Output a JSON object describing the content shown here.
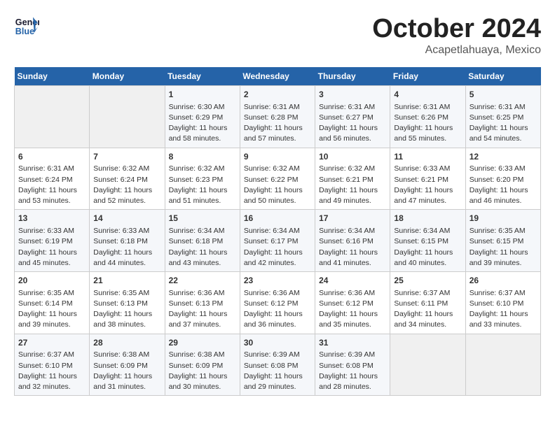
{
  "logo": {
    "line1": "General",
    "line2": "Blue"
  },
  "title": "October 2024",
  "subtitle": "Acapetlahuaya, Mexico",
  "days_of_week": [
    "Sunday",
    "Monday",
    "Tuesday",
    "Wednesday",
    "Thursday",
    "Friday",
    "Saturday"
  ],
  "weeks": [
    [
      {
        "day": "",
        "info": ""
      },
      {
        "day": "",
        "info": ""
      },
      {
        "day": "1",
        "info": "Sunrise: 6:30 AM\nSunset: 6:29 PM\nDaylight: 11 hours\nand 58 minutes."
      },
      {
        "day": "2",
        "info": "Sunrise: 6:31 AM\nSunset: 6:28 PM\nDaylight: 11 hours\nand 57 minutes."
      },
      {
        "day": "3",
        "info": "Sunrise: 6:31 AM\nSunset: 6:27 PM\nDaylight: 11 hours\nand 56 minutes."
      },
      {
        "day": "4",
        "info": "Sunrise: 6:31 AM\nSunset: 6:26 PM\nDaylight: 11 hours\nand 55 minutes."
      },
      {
        "day": "5",
        "info": "Sunrise: 6:31 AM\nSunset: 6:25 PM\nDaylight: 11 hours\nand 54 minutes."
      }
    ],
    [
      {
        "day": "6",
        "info": "Sunrise: 6:31 AM\nSunset: 6:24 PM\nDaylight: 11 hours\nand 53 minutes."
      },
      {
        "day": "7",
        "info": "Sunrise: 6:32 AM\nSunset: 6:24 PM\nDaylight: 11 hours\nand 52 minutes."
      },
      {
        "day": "8",
        "info": "Sunrise: 6:32 AM\nSunset: 6:23 PM\nDaylight: 11 hours\nand 51 minutes."
      },
      {
        "day": "9",
        "info": "Sunrise: 6:32 AM\nSunset: 6:22 PM\nDaylight: 11 hours\nand 50 minutes."
      },
      {
        "day": "10",
        "info": "Sunrise: 6:32 AM\nSunset: 6:21 PM\nDaylight: 11 hours\nand 49 minutes."
      },
      {
        "day": "11",
        "info": "Sunrise: 6:33 AM\nSunset: 6:21 PM\nDaylight: 11 hours\nand 47 minutes."
      },
      {
        "day": "12",
        "info": "Sunrise: 6:33 AM\nSunset: 6:20 PM\nDaylight: 11 hours\nand 46 minutes."
      }
    ],
    [
      {
        "day": "13",
        "info": "Sunrise: 6:33 AM\nSunset: 6:19 PM\nDaylight: 11 hours\nand 45 minutes."
      },
      {
        "day": "14",
        "info": "Sunrise: 6:33 AM\nSunset: 6:18 PM\nDaylight: 11 hours\nand 44 minutes."
      },
      {
        "day": "15",
        "info": "Sunrise: 6:34 AM\nSunset: 6:18 PM\nDaylight: 11 hours\nand 43 minutes."
      },
      {
        "day": "16",
        "info": "Sunrise: 6:34 AM\nSunset: 6:17 PM\nDaylight: 11 hours\nand 42 minutes."
      },
      {
        "day": "17",
        "info": "Sunrise: 6:34 AM\nSunset: 6:16 PM\nDaylight: 11 hours\nand 41 minutes."
      },
      {
        "day": "18",
        "info": "Sunrise: 6:34 AM\nSunset: 6:15 PM\nDaylight: 11 hours\nand 40 minutes."
      },
      {
        "day": "19",
        "info": "Sunrise: 6:35 AM\nSunset: 6:15 PM\nDaylight: 11 hours\nand 39 minutes."
      }
    ],
    [
      {
        "day": "20",
        "info": "Sunrise: 6:35 AM\nSunset: 6:14 PM\nDaylight: 11 hours\nand 39 minutes."
      },
      {
        "day": "21",
        "info": "Sunrise: 6:35 AM\nSunset: 6:13 PM\nDaylight: 11 hours\nand 38 minutes."
      },
      {
        "day": "22",
        "info": "Sunrise: 6:36 AM\nSunset: 6:13 PM\nDaylight: 11 hours\nand 37 minutes."
      },
      {
        "day": "23",
        "info": "Sunrise: 6:36 AM\nSunset: 6:12 PM\nDaylight: 11 hours\nand 36 minutes."
      },
      {
        "day": "24",
        "info": "Sunrise: 6:36 AM\nSunset: 6:12 PM\nDaylight: 11 hours\nand 35 minutes."
      },
      {
        "day": "25",
        "info": "Sunrise: 6:37 AM\nSunset: 6:11 PM\nDaylight: 11 hours\nand 34 minutes."
      },
      {
        "day": "26",
        "info": "Sunrise: 6:37 AM\nSunset: 6:10 PM\nDaylight: 11 hours\nand 33 minutes."
      }
    ],
    [
      {
        "day": "27",
        "info": "Sunrise: 6:37 AM\nSunset: 6:10 PM\nDaylight: 11 hours\nand 32 minutes."
      },
      {
        "day": "28",
        "info": "Sunrise: 6:38 AM\nSunset: 6:09 PM\nDaylight: 11 hours\nand 31 minutes."
      },
      {
        "day": "29",
        "info": "Sunrise: 6:38 AM\nSunset: 6:09 PM\nDaylight: 11 hours\nand 30 minutes."
      },
      {
        "day": "30",
        "info": "Sunrise: 6:39 AM\nSunset: 6:08 PM\nDaylight: 11 hours\nand 29 minutes."
      },
      {
        "day": "31",
        "info": "Sunrise: 6:39 AM\nSunset: 6:08 PM\nDaylight: 11 hours\nand 28 minutes."
      },
      {
        "day": "",
        "info": ""
      },
      {
        "day": "",
        "info": ""
      }
    ]
  ]
}
